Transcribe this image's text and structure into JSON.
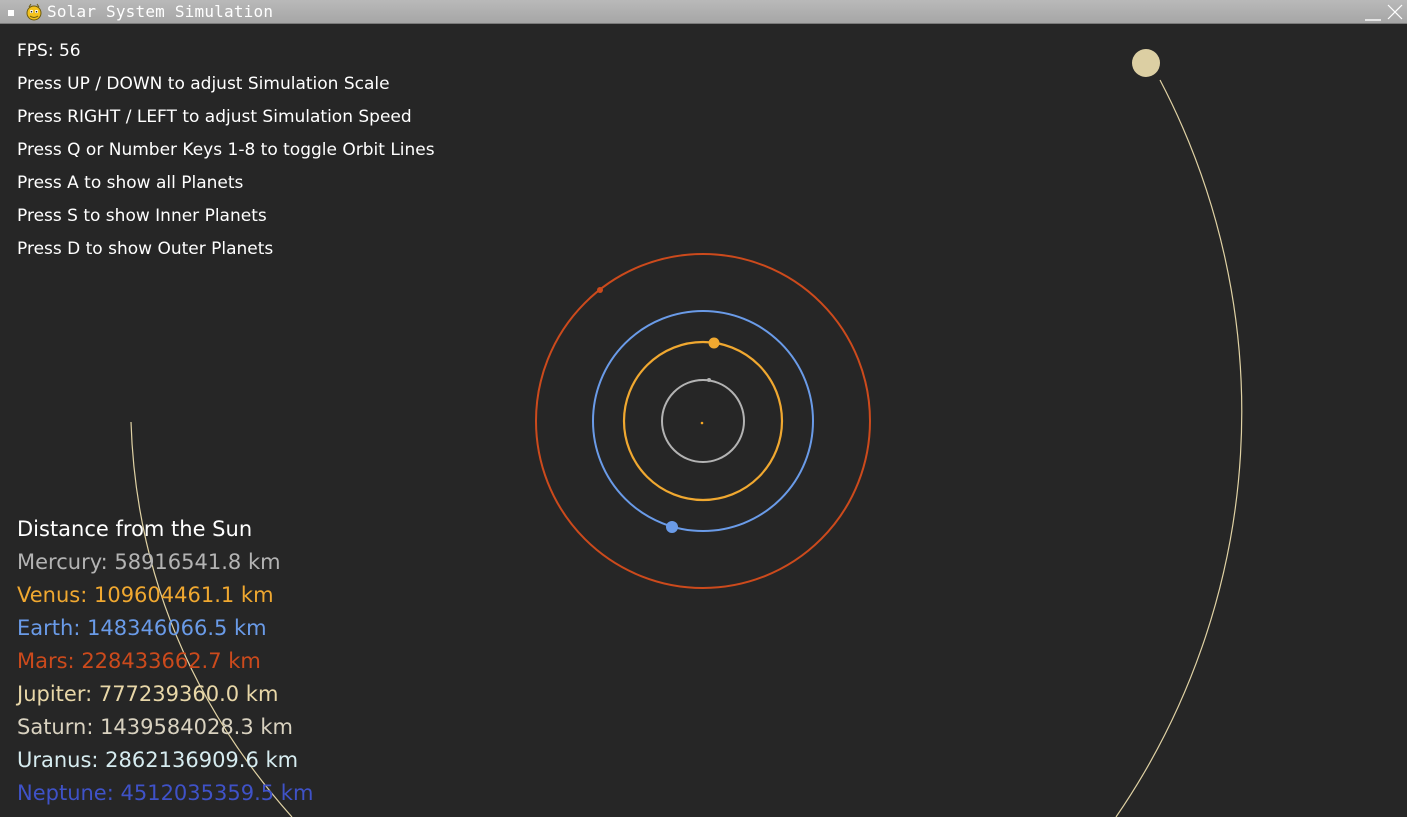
{
  "window": {
    "title": "Solar System Simulation"
  },
  "hud": {
    "fps": "FPS: 56",
    "instructions": [
      "Press UP / DOWN to adjust Simulation Scale",
      "Press RIGHT / LEFT to adjust Simulation Speed",
      "Press Q or Number Keys 1-8 to toggle Orbit Lines",
      "Press A to show all Planets",
      "Press S to show Inner Planets",
      "Press D to show Outer Planets"
    ]
  },
  "distances": {
    "heading": "Distance from the Sun",
    "rows": [
      {
        "text": "Mercury: 58916541.8 km",
        "color": "#b3b3b3"
      },
      {
        "text": "Venus: 109604461.1 km",
        "color": "#f0a830"
      },
      {
        "text": "Earth: 148346066.5 km",
        "color": "#6a9be8"
      },
      {
        "text": "Mars: 228433662.7 km",
        "color": "#cc4a1c"
      },
      {
        "text": "Jupiter: 777239360.0 km",
        "color": "#e8d7a8"
      },
      {
        "text": "Saturn: 1439584028.3 km",
        "color": "#d9d2c0"
      },
      {
        "text": "Uranus: 2862136909.6 km",
        "color": "#d6ecf0"
      },
      {
        "text": "Neptune: 4512035359.5 km",
        "color": "#3f52c8"
      }
    ]
  },
  "colors": {
    "background": "#262626",
    "sun": "#f5a623",
    "mercury": "#b3b3b3",
    "venus": "#f0a830",
    "earth": "#6a9be8",
    "mars": "#cc4a1c",
    "jupiter": "#e0d2a4"
  },
  "icons": {
    "window_menu": "square-dot-icon",
    "app": "pygame-snake-icon",
    "minimize": "minimize-icon",
    "close": "close-icon"
  }
}
